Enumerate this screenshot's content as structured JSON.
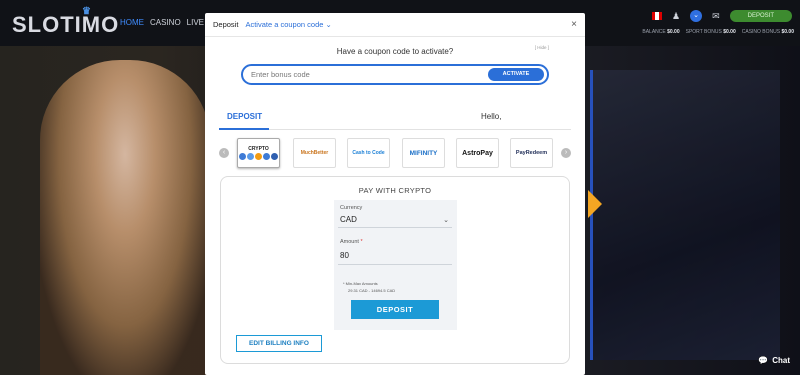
{
  "site": {
    "logo": "SLOTIMO",
    "nav": [
      "HOME",
      "CASINO",
      "LIVE CASI"
    ],
    "deposit_label": "DEPOSIT",
    "balances": [
      {
        "label": "BALANCE",
        "value": "$0.00"
      },
      {
        "label": "SPORT BONUS",
        "value": "$0.00"
      },
      {
        "label": "CASINO BONUS",
        "value": "$0.00"
      }
    ],
    "chat_label": "Chat"
  },
  "modal": {
    "title": "Deposit",
    "coupon_link": "Activate a coupon code ⌄",
    "close": "×",
    "coupon_question": "Have a coupon code to activate?",
    "hide_label": "[ Hide ]",
    "coupon_placeholder": "Enter bonus code",
    "activate_label": "ACTIVATE",
    "tab_deposit": "DEPOSIT",
    "hello": "Hello,",
    "providers": [
      {
        "name": "CRYPTO",
        "selected": true
      },
      {
        "name": "MuchBetter",
        "selected": false
      },
      {
        "name": "Cash to Code",
        "selected": false
      },
      {
        "name": "MIFINITY",
        "selected": false
      },
      {
        "name": "AstroPay",
        "selected": false
      },
      {
        "name": "PayRedeem",
        "selected": false
      }
    ],
    "pay_title": "PAY WITH CRYPTO",
    "currency_label": "Currency",
    "currency_value": "CAD",
    "amount_label": "Amount",
    "amount_required": "*",
    "amount_value": "80",
    "limits_label": "* Min-Max Amounts",
    "limits_value": "29.31 CAD - 14694.5 CAD",
    "deposit_button": "DEPOSIT",
    "billing_button": "EDIT BILLING INFO"
  },
  "colors": {
    "accent": "#2b6fd8",
    "button": "#1c9ad6",
    "green": "#3d8b2f"
  }
}
